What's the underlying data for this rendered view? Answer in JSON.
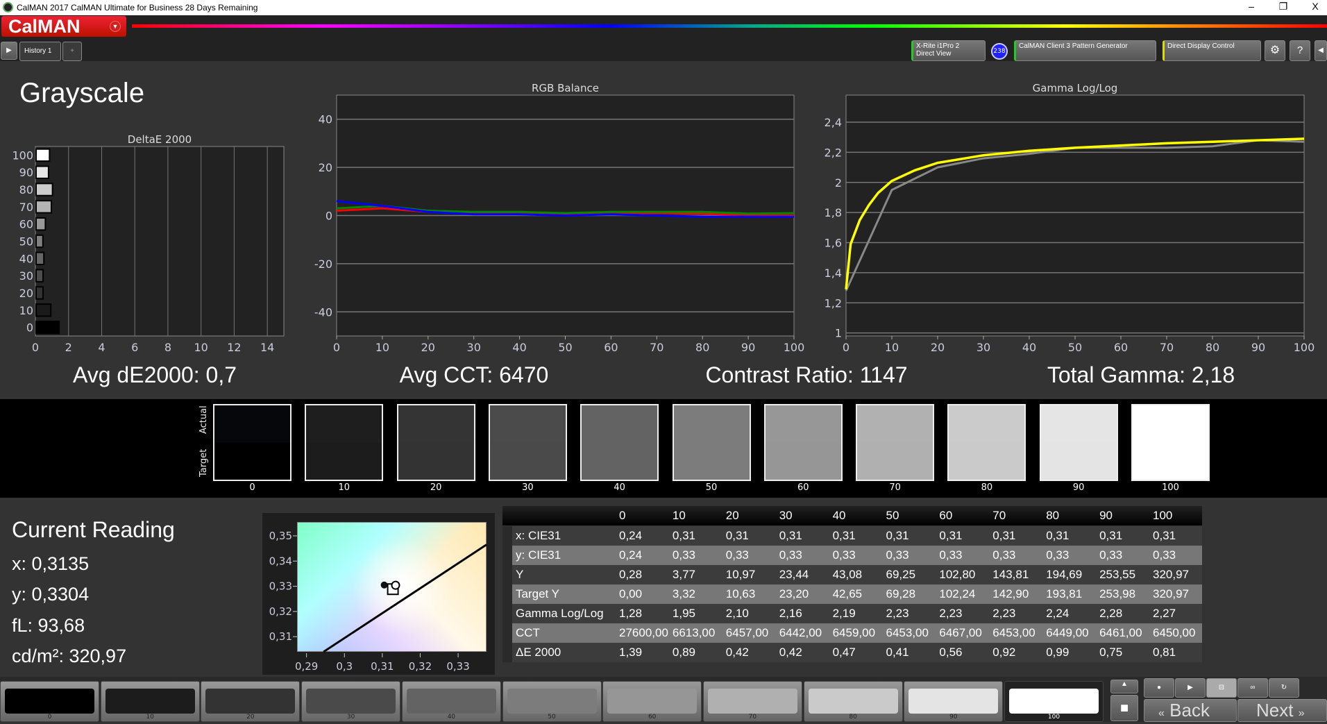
{
  "window": {
    "title": "CalMAN 2017 CalMAN Ultimate for Business 28 Days Remaining",
    "minimize": "–",
    "restore": "❐",
    "close": "X"
  },
  "header": {
    "logo": "CalMAN",
    "rainbow": [
      "#ff0000",
      "#ff00ff",
      "#8800ff",
      "#0000ff",
      "#00aa88",
      "#00ff00",
      "#ffff00",
      "#ff8800",
      "#ff0000"
    ]
  },
  "toolbar": {
    "history_tab": "History 1",
    "add_tab": "+",
    "meter": "X-Rite i1Pro 2",
    "meter_mode": "Direct View",
    "meter_badge": "238",
    "pattern_gen": "CalMAN Client 3 Pattern Generator",
    "display_control": "Direct Display Control",
    "accent_meter": "#22cc22",
    "accent_display": "#dddd00"
  },
  "page": {
    "title": "Grayscale"
  },
  "summary": {
    "avg_de": "Avg dE2000: 0,7",
    "avg_cct": "Avg CCT: 6470",
    "contrast": "Contrast Ratio: 1147",
    "total_gamma": "Total Gamma: 2,18"
  },
  "chart_data": [
    {
      "type": "bar",
      "orientation": "horizontal",
      "title": "DeltaE 2000",
      "categories": [
        "0",
        "10",
        "20",
        "30",
        "40",
        "50",
        "60",
        "70",
        "80",
        "90",
        "100"
      ],
      "values": [
        1.39,
        0.89,
        0.42,
        0.42,
        0.47,
        0.41,
        0.56,
        0.92,
        0.99,
        0.75,
        0.81
      ],
      "xlim": [
        0,
        15
      ],
      "xticks": [
        "0",
        "2",
        "4",
        "6",
        "8",
        "10",
        "12",
        "14"
      ],
      "grid": true
    },
    {
      "type": "line",
      "title": "RGB Balance",
      "x": [
        0,
        10,
        20,
        30,
        40,
        50,
        60,
        70,
        80,
        90,
        100
      ],
      "ylim": [
        -50,
        50
      ],
      "yticks": [
        "40",
        "20",
        "0",
        "-20",
        "-40"
      ],
      "xticks": [
        "0",
        "10",
        "20",
        "30",
        "40",
        "50",
        "60",
        "70",
        "80",
        "90",
        "100"
      ],
      "grid": true,
      "series": [
        {
          "color": "#ff0000",
          "values": [
            2,
            3,
            1.5,
            1,
            1,
            0.5,
            1,
            1,
            0.8,
            0,
            0
          ]
        },
        {
          "color": "#008800",
          "values": [
            3,
            4,
            2,
            1.5,
            1.5,
            1,
            1.5,
            1.5,
            1.5,
            0.8,
            1
          ]
        },
        {
          "color": "#0000ff",
          "values": [
            6,
            4,
            1.5,
            0.5,
            0.5,
            0,
            0.5,
            0,
            -0.5,
            -0.5,
            -0.5
          ]
        }
      ]
    },
    {
      "type": "line",
      "title": "Gamma Log/Log",
      "ylim": [
        0.98,
        2.58
      ],
      "yticks": [
        "1",
        "1,2",
        "1,4",
        "1,6",
        "1,8",
        "2",
        "2,2",
        "2,4"
      ],
      "xticks": [
        "0",
        "10",
        "20",
        "30",
        "40",
        "50",
        "60",
        "70",
        "80",
        "90",
        "100"
      ],
      "grid": true,
      "series": [
        {
          "color": "#888888",
          "x": [
            0,
            10,
            20,
            30,
            40,
            50,
            60,
            70,
            80,
            90,
            100
          ],
          "values": [
            1.28,
            1.95,
            2.1,
            2.16,
            2.19,
            2.23,
            2.23,
            2.23,
            2.24,
            2.28,
            2.27
          ]
        },
        {
          "color": "#ffff00",
          "x": [
            0,
            1,
            3,
            5,
            7,
            10,
            15,
            20,
            30,
            40,
            50,
            60,
            70,
            80,
            90,
            100
          ],
          "values": [
            1.29,
            1.59,
            1.75,
            1.85,
            1.93,
            2.01,
            2.08,
            2.13,
            2.18,
            2.21,
            2.23,
            2.245,
            2.26,
            2.27,
            2.28,
            2.29
          ]
        }
      ]
    },
    {
      "type": "scatter",
      "xlim": [
        0.2875,
        0.3375
      ],
      "ylim": [
        0.304,
        0.3555
      ],
      "xticks": [
        "0,29",
        "0,3",
        "0,31",
        "0,32",
        "0,33"
      ],
      "yticks": [
        "0,31",
        "0,32",
        "0,33",
        "0,34",
        "0,35"
      ],
      "points": [
        {
          "role": "previous",
          "x": 0.3105,
          "y": 0.3305
        },
        {
          "role": "target",
          "x": 0.3127,
          "y": 0.329
        },
        {
          "role": "measured",
          "x": 0.3135,
          "y": 0.3304
        }
      ],
      "locus": [
        [
          0.2945,
          0.304
        ],
        [
          0.3375,
          0.3465
        ]
      ]
    }
  ],
  "swatches": {
    "actual_label": "Actual",
    "target_label": "Target",
    "levels": [
      "0",
      "10",
      "20",
      "30",
      "40",
      "50",
      "60",
      "70",
      "80",
      "90",
      "100"
    ],
    "actual": [
      "#05070b",
      "#1e1e1e",
      "#343434",
      "#4b4b4b",
      "#636363",
      "#7c7c7c",
      "#979797",
      "#b1b1b1",
      "#cbcbcb",
      "#e5e5e5",
      "#ffffff"
    ],
    "target": [
      "#000000",
      "#1c1c1c",
      "#333333",
      "#4a4a4a",
      "#636363",
      "#7c7c7c",
      "#969696",
      "#b0b0b0",
      "#cacaca",
      "#e4e4e4",
      "#ffffff"
    ]
  },
  "reading": {
    "title": "Current Reading",
    "x": "x: 0,3135",
    "y": "y: 0,3304",
    "fl": "fL: 93,68",
    "cdm2": "cd/m²: 320,97"
  },
  "table": {
    "columns": [
      "0",
      "10",
      "20",
      "30",
      "40",
      "50",
      "60",
      "70",
      "80",
      "90",
      "100"
    ],
    "rows": [
      {
        "label": "x: CIE31",
        "values": [
          "0,24",
          "0,31",
          "0,31",
          "0,31",
          "0,31",
          "0,31",
          "0,31",
          "0,31",
          "0,31",
          "0,31",
          "0,31"
        ]
      },
      {
        "label": "y: CIE31",
        "values": [
          "0,24",
          "0,33",
          "0,33",
          "0,33",
          "0,33",
          "0,33",
          "0,33",
          "0,33",
          "0,33",
          "0,33",
          "0,33"
        ]
      },
      {
        "label": "Y",
        "values": [
          "0,28",
          "3,77",
          "10,97",
          "23,44",
          "43,08",
          "69,25",
          "102,80",
          "143,81",
          "194,69",
          "253,55",
          "320,97"
        ]
      },
      {
        "label": "Target Y",
        "values": [
          "0,00",
          "3,32",
          "10,63",
          "23,20",
          "42,65",
          "69,28",
          "102,24",
          "142,90",
          "193,81",
          "253,98",
          "320,97"
        ]
      },
      {
        "label": "Gamma Log/Log",
        "values": [
          "1,28",
          "1,95",
          "2,10",
          "2,16",
          "2,19",
          "2,23",
          "2,23",
          "2,23",
          "2,24",
          "2,28",
          "2,27"
        ]
      },
      {
        "label": "CCT",
        "values": [
          "27600,00",
          "6613,00",
          "6457,00",
          "6442,00",
          "6459,00",
          "6453,00",
          "6467,00",
          "6453,00",
          "6449,00",
          "6461,00",
          "6450,00"
        ]
      },
      {
        "label": "ΔE 2000",
        "values": [
          "1,39",
          "0,89",
          "0,42",
          "0,42",
          "0,47",
          "0,41",
          "0,56",
          "0,92",
          "0,99",
          "0,75",
          "0,81"
        ]
      }
    ]
  },
  "bottom": {
    "swatch_labels": [
      "0",
      "10",
      "20",
      "30",
      "40",
      "50",
      "60",
      "70",
      "80",
      "90",
      "100"
    ],
    "swatch_colors": [
      "#000000",
      "#1c1c1c",
      "#333333",
      "#4a4a4a",
      "#636363",
      "#7c7c7c",
      "#969696",
      "#b0b0b0",
      "#cacaca",
      "#e4e4e4",
      "#ffffff"
    ],
    "selected": "100",
    "back": "Back",
    "next": "Next"
  }
}
